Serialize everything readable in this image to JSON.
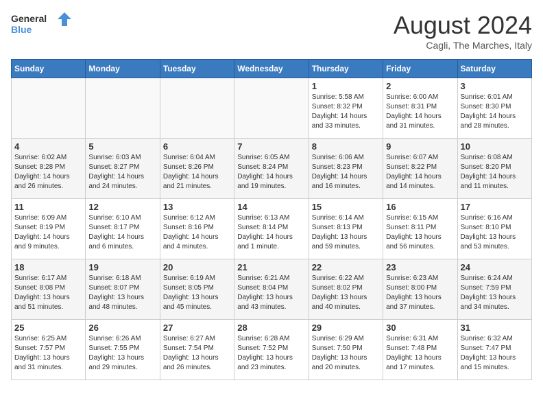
{
  "header": {
    "logo_line1": "General",
    "logo_line2": "Blue",
    "month_year": "August 2024",
    "location": "Cagli, The Marches, Italy"
  },
  "weekdays": [
    "Sunday",
    "Monday",
    "Tuesday",
    "Wednesday",
    "Thursday",
    "Friday",
    "Saturday"
  ],
  "weeks": [
    [
      {
        "day": "",
        "info": ""
      },
      {
        "day": "",
        "info": ""
      },
      {
        "day": "",
        "info": ""
      },
      {
        "day": "",
        "info": ""
      },
      {
        "day": "1",
        "info": "Sunrise: 5:58 AM\nSunset: 8:32 PM\nDaylight: 14 hours\nand 33 minutes."
      },
      {
        "day": "2",
        "info": "Sunrise: 6:00 AM\nSunset: 8:31 PM\nDaylight: 14 hours\nand 31 minutes."
      },
      {
        "day": "3",
        "info": "Sunrise: 6:01 AM\nSunset: 8:30 PM\nDaylight: 14 hours\nand 28 minutes."
      }
    ],
    [
      {
        "day": "4",
        "info": "Sunrise: 6:02 AM\nSunset: 8:28 PM\nDaylight: 14 hours\nand 26 minutes."
      },
      {
        "day": "5",
        "info": "Sunrise: 6:03 AM\nSunset: 8:27 PM\nDaylight: 14 hours\nand 24 minutes."
      },
      {
        "day": "6",
        "info": "Sunrise: 6:04 AM\nSunset: 8:26 PM\nDaylight: 14 hours\nand 21 minutes."
      },
      {
        "day": "7",
        "info": "Sunrise: 6:05 AM\nSunset: 8:24 PM\nDaylight: 14 hours\nand 19 minutes."
      },
      {
        "day": "8",
        "info": "Sunrise: 6:06 AM\nSunset: 8:23 PM\nDaylight: 14 hours\nand 16 minutes."
      },
      {
        "day": "9",
        "info": "Sunrise: 6:07 AM\nSunset: 8:22 PM\nDaylight: 14 hours\nand 14 minutes."
      },
      {
        "day": "10",
        "info": "Sunrise: 6:08 AM\nSunset: 8:20 PM\nDaylight: 14 hours\nand 11 minutes."
      }
    ],
    [
      {
        "day": "11",
        "info": "Sunrise: 6:09 AM\nSunset: 8:19 PM\nDaylight: 14 hours\nand 9 minutes."
      },
      {
        "day": "12",
        "info": "Sunrise: 6:10 AM\nSunset: 8:17 PM\nDaylight: 14 hours\nand 6 minutes."
      },
      {
        "day": "13",
        "info": "Sunrise: 6:12 AM\nSunset: 8:16 PM\nDaylight: 14 hours\nand 4 minutes."
      },
      {
        "day": "14",
        "info": "Sunrise: 6:13 AM\nSunset: 8:14 PM\nDaylight: 14 hours\nand 1 minute."
      },
      {
        "day": "15",
        "info": "Sunrise: 6:14 AM\nSunset: 8:13 PM\nDaylight: 13 hours\nand 59 minutes."
      },
      {
        "day": "16",
        "info": "Sunrise: 6:15 AM\nSunset: 8:11 PM\nDaylight: 13 hours\nand 56 minutes."
      },
      {
        "day": "17",
        "info": "Sunrise: 6:16 AM\nSunset: 8:10 PM\nDaylight: 13 hours\nand 53 minutes."
      }
    ],
    [
      {
        "day": "18",
        "info": "Sunrise: 6:17 AM\nSunset: 8:08 PM\nDaylight: 13 hours\nand 51 minutes."
      },
      {
        "day": "19",
        "info": "Sunrise: 6:18 AM\nSunset: 8:07 PM\nDaylight: 13 hours\nand 48 minutes."
      },
      {
        "day": "20",
        "info": "Sunrise: 6:19 AM\nSunset: 8:05 PM\nDaylight: 13 hours\nand 45 minutes."
      },
      {
        "day": "21",
        "info": "Sunrise: 6:21 AM\nSunset: 8:04 PM\nDaylight: 13 hours\nand 43 minutes."
      },
      {
        "day": "22",
        "info": "Sunrise: 6:22 AM\nSunset: 8:02 PM\nDaylight: 13 hours\nand 40 minutes."
      },
      {
        "day": "23",
        "info": "Sunrise: 6:23 AM\nSunset: 8:00 PM\nDaylight: 13 hours\nand 37 minutes."
      },
      {
        "day": "24",
        "info": "Sunrise: 6:24 AM\nSunset: 7:59 PM\nDaylight: 13 hours\nand 34 minutes."
      }
    ],
    [
      {
        "day": "25",
        "info": "Sunrise: 6:25 AM\nSunset: 7:57 PM\nDaylight: 13 hours\nand 31 minutes."
      },
      {
        "day": "26",
        "info": "Sunrise: 6:26 AM\nSunset: 7:55 PM\nDaylight: 13 hours\nand 29 minutes."
      },
      {
        "day": "27",
        "info": "Sunrise: 6:27 AM\nSunset: 7:54 PM\nDaylight: 13 hours\nand 26 minutes."
      },
      {
        "day": "28",
        "info": "Sunrise: 6:28 AM\nSunset: 7:52 PM\nDaylight: 13 hours\nand 23 minutes."
      },
      {
        "day": "29",
        "info": "Sunrise: 6:29 AM\nSunset: 7:50 PM\nDaylight: 13 hours\nand 20 minutes."
      },
      {
        "day": "30",
        "info": "Sunrise: 6:31 AM\nSunset: 7:48 PM\nDaylight: 13 hours\nand 17 minutes."
      },
      {
        "day": "31",
        "info": "Sunrise: 6:32 AM\nSunset: 7:47 PM\nDaylight: 13 hours\nand 15 minutes."
      }
    ]
  ]
}
